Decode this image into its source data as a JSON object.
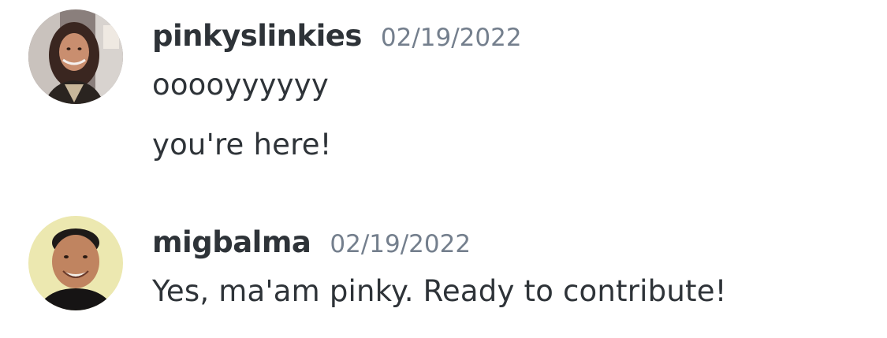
{
  "messages": [
    {
      "username": "pinkyslinkies",
      "timestamp": "02/19/2022",
      "avatar_icon": "user-avatar-woman",
      "lines": [
        "ooooyyyyyy",
        "you're here!"
      ]
    },
    {
      "username": "migbalma",
      "timestamp": "02/19/2022",
      "avatar_icon": "user-avatar-man",
      "lines": [
        "Yes, ma'am pinky. Ready to contribute!"
      ]
    }
  ],
  "colors": {
    "background": "#ffffff",
    "username": "#2e3338",
    "timestamp": "#747f8d",
    "message_text": "#2e3338"
  }
}
